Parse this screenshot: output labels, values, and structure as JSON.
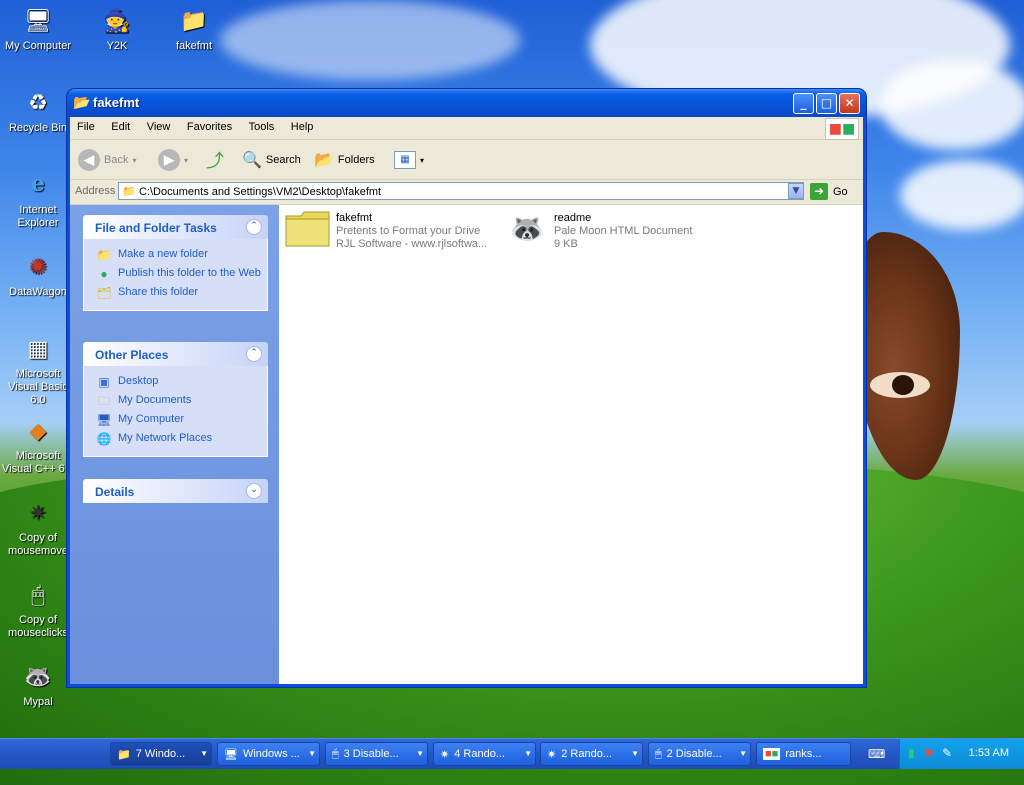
{
  "desktop": {
    "icons": [
      {
        "label": "My Computer",
        "icon": "computer-icon"
      },
      {
        "label": "Y2K",
        "icon": "wizard-icon"
      },
      {
        "label": "fakefmt",
        "icon": "folder-icon"
      },
      {
        "label": "Recycle Bin",
        "icon": "recycle-bin-icon"
      },
      {
        "label": "Internet Explorer",
        "icon": "internet-explorer-icon"
      },
      {
        "label": "DataWagon",
        "icon": "datawagon-shortcut-icon"
      },
      {
        "label": "Microsoft Visual Basic 6.0",
        "icon": "vb6-shortcut-icon"
      },
      {
        "label": "Microsoft Visual C++ 6.0",
        "icon": "vc6-shortcut-icon"
      },
      {
        "label": "Copy of mousemove",
        "icon": "compass-icon"
      },
      {
        "label": "Copy of mouseclicks",
        "icon": "mouse-icon"
      },
      {
        "label": "Mypal",
        "icon": "raccoon-shortcut-icon"
      },
      {
        "label": "fakefmt",
        "icon": "file-icon"
      }
    ]
  },
  "window": {
    "title": "fakefmt",
    "menu": [
      "File",
      "Edit",
      "View",
      "Favorites",
      "Tools",
      "Help"
    ],
    "toolbar": {
      "back": "Back",
      "search": "Search",
      "folders": "Folders"
    },
    "address": {
      "label": "Address",
      "value": "C:\\Documents and Settings\\VM2\\Desktop\\fakefmt",
      "go": "Go"
    },
    "tasks_panel": {
      "title": "File and Folder Tasks",
      "links": [
        {
          "label": "Make a new folder",
          "icon": "new-folder-icon"
        },
        {
          "label": "Publish this folder to the Web",
          "icon": "publish-web-icon"
        },
        {
          "label": "Share this folder",
          "icon": "share-folder-icon"
        }
      ]
    },
    "places_panel": {
      "title": "Other Places",
      "links": [
        {
          "label": "Desktop",
          "icon": "desktop-icon"
        },
        {
          "label": "My Documents",
          "icon": "documents-icon"
        },
        {
          "label": "My Computer",
          "icon": "computer-icon"
        },
        {
          "label": "My Network Places",
          "icon": "network-icon"
        }
      ]
    },
    "details_panel": {
      "title": "Details"
    },
    "files": [
      {
        "name": "fakefmt",
        "line1": "Pretents to Format your Drive",
        "line2": "RJL Software - www.rjlsoftwa..."
      },
      {
        "name": "readme",
        "line1": "Pale Moon HTML Document",
        "line2": "9 KB"
      }
    ]
  },
  "taskbar": {
    "tasks": [
      {
        "label": "7 Windo...",
        "icon": "folder-icon",
        "active": true
      },
      {
        "label": "Windows ...",
        "icon": "monitor-icon",
        "active": false
      },
      {
        "label": "3 Disable...",
        "icon": "mouse-icon",
        "active": false
      },
      {
        "label": "4 Rando...",
        "icon": "compass-icon",
        "active": false
      },
      {
        "label": "2 Rando...",
        "icon": "compass-icon",
        "active": false
      },
      {
        "label": "2 Disable...",
        "icon": "mouse-icon",
        "active": false
      },
      {
        "label": "ranks...",
        "icon": "windows-logo-icon",
        "active": false
      }
    ],
    "clock": "1:53 AM"
  }
}
